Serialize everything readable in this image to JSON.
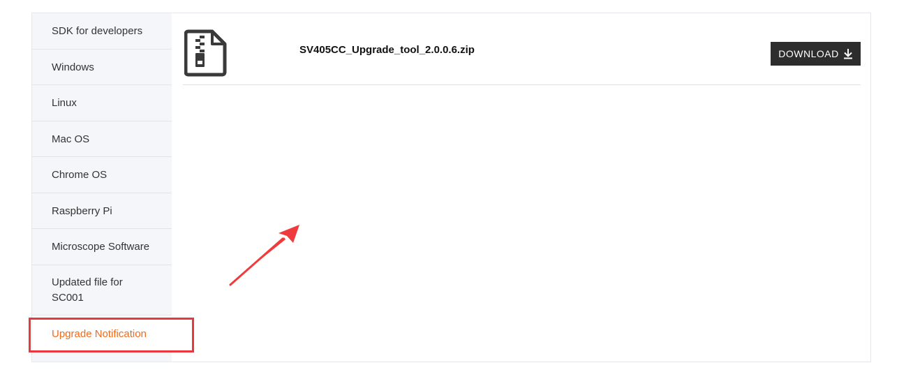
{
  "sidebar": {
    "items": [
      {
        "label": "SDK for developers"
      },
      {
        "label": "Windows"
      },
      {
        "label": "Linux"
      },
      {
        "label": "Mac OS"
      },
      {
        "label": "Chrome OS"
      },
      {
        "label": "Raspberry Pi"
      },
      {
        "label": "Microscope Software"
      },
      {
        "label": "Updated file for SC001"
      },
      {
        "label": "Upgrade Notification",
        "active": true
      }
    ]
  },
  "main": {
    "file": {
      "icon": "zip-file-icon",
      "name": "SV405CC_Upgrade_tool_2.0.0.6.zip",
      "download_label": "DOWNLOAD",
      "download_icon": "download-arrow-icon"
    }
  },
  "annotations": {
    "highlight_color": "#e8383d",
    "arrow_color": "#ef3b3b",
    "active_color": "#f26a1b"
  }
}
